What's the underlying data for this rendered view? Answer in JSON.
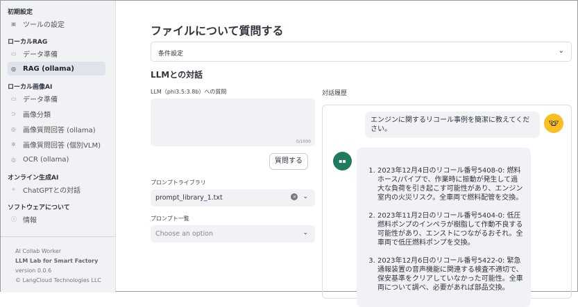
{
  "sidebar": {
    "sections": [
      {
        "title": "初期設定",
        "items": [
          {
            "label": "ツールの設定",
            "icon": "gear-icon"
          }
        ]
      },
      {
        "title": "ローカルRAG",
        "items": [
          {
            "label": "データ準備",
            "icon": "folder-icon"
          },
          {
            "label": "RAG (ollama)",
            "icon": "brain-icon",
            "active": true
          }
        ]
      },
      {
        "title": "ローカル画像AI",
        "items": [
          {
            "label": "データ準備",
            "icon": "folder-icon"
          },
          {
            "label": "画像分類",
            "icon": "label-icon"
          },
          {
            "label": "画像質問回答 (ollama)",
            "icon": "brain-icon"
          },
          {
            "label": "画像質問回答 (個別VLM)",
            "icon": "hub-icon"
          },
          {
            "label": "OCR (ollama)",
            "icon": "brain-icon"
          }
        ]
      },
      {
        "title": "オンライン生成AI",
        "items": [
          {
            "label": "ChatGPTとの対話",
            "icon": "sparkle-icon"
          }
        ]
      },
      {
        "title": "ソフトウェアについて",
        "items": [
          {
            "label": "情報",
            "icon": "help-icon"
          }
        ]
      }
    ],
    "footer": {
      "app": "AI Collab Worker",
      "product": "LLM Lab for Smart Factory",
      "version": "version 0.0.6",
      "copyright": "© LangCloud Technologies LLC"
    }
  },
  "main": {
    "title": "ファイルについて質問する",
    "expander": "条件設定",
    "chat_heading": "LLMとの対話",
    "question_label": "LLM（phi3.5:3.8b）への質問",
    "question_value": "",
    "char_count": "0/1000",
    "ask_button": "質問する",
    "library_label": "プロンプトライブラリ",
    "library_value": "prompt_library_1.txt",
    "prompt_list_label": "プロンプト一覧",
    "prompt_list_placeholder": "Choose an option",
    "history_label": "対話履歴",
    "messages": {
      "user": "エンジンに関するリコール事例を簡潔に教えてください。",
      "assistant": [
        "2023年12月4日のリコール番号5408-0: 燃料ホース/パイプで、作業時に振動が発生して過大な負荷を引き起こす可能性があり、エンジン室内の火災リスク。全車両で燃料配管を交換。",
        "2023年11月2日のリコール番号5404-0: 低圧燃料ポンプのインペラが樹脂して作動不良する可能性があり、エンストにつながるおそれ。全車両で低圧燃料ポンプを交換。",
        "2023年12月6日のリコール番号5422-0: 緊急通報装置の音声機能に関連する検査不適切で、保安基準をクリアしていなかった可能性。全車両について調べ、必要があれば部品交換。"
      ]
    }
  }
}
